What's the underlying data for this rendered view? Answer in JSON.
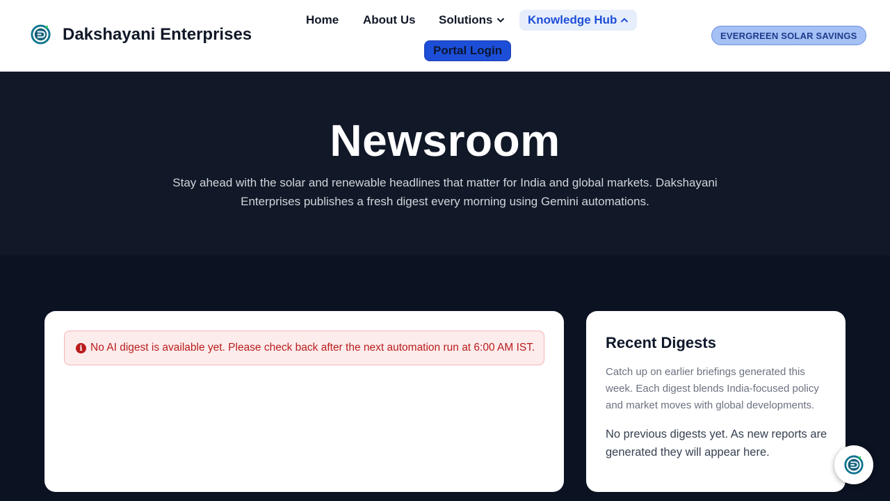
{
  "brand": {
    "name": "Dakshayani Enterprises",
    "logo_icon": "dakshayani-logo-icon"
  },
  "nav": {
    "home": "Home",
    "about": "About Us",
    "solutions": "Solutions",
    "knowledge_hub": "Knowledge Hub",
    "portal_login": "Portal Login"
  },
  "promo_badge": "EVERGREEN SOLAR SAVINGS",
  "hero": {
    "title": "Newsroom",
    "subtitle": "Stay ahead with the solar and renewable headlines that matter for India and global markets. Dakshayani Enterprises publishes a fresh digest every morning using Gemini automations."
  },
  "alert": {
    "icon": "info-icon",
    "message": "No AI digest is available yet. Please check back after the next automation run at 6:00 AM IST."
  },
  "recent_digests": {
    "title": "Recent Digests",
    "description": "Catch up on earlier briefings generated this week. Each digest blends India-focused policy and market moves with global developments.",
    "empty_message": "No previous digests yet. As new reports are generated they will appear here."
  },
  "colors": {
    "accent": "#1d4ed8",
    "hero_bg": "#111827",
    "page_bg": "#0b1222",
    "alert_text": "#b91c1c"
  }
}
